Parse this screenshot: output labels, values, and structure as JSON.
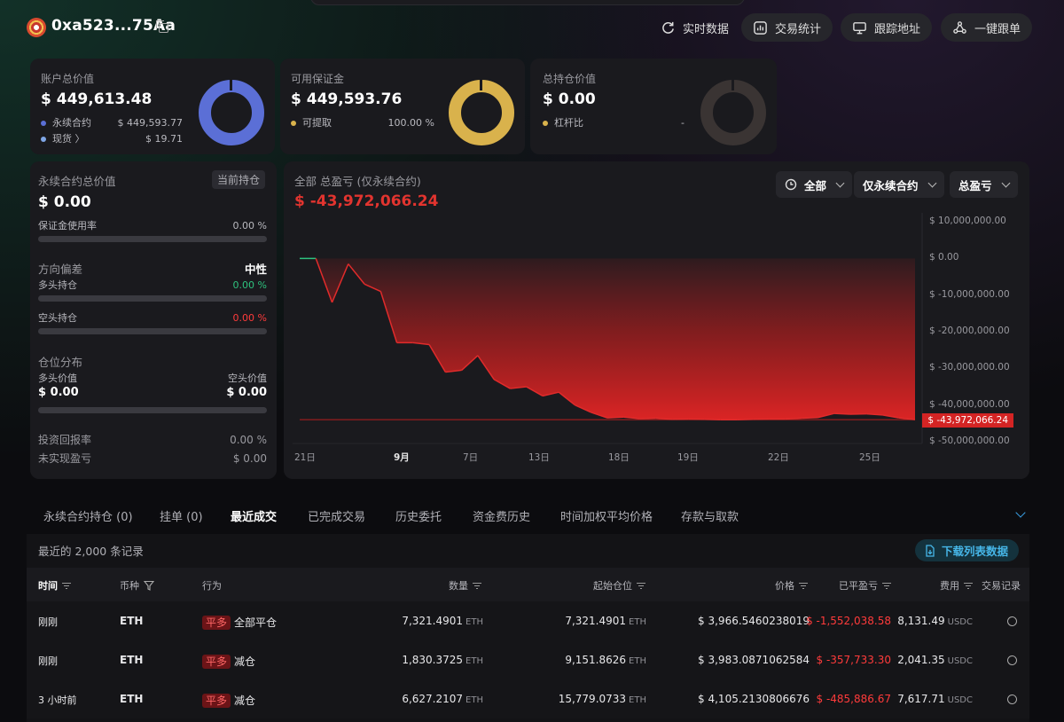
{
  "header": {
    "address": "0xa523...75Aa",
    "buttons": [
      "实时数据",
      "交易统计",
      "跟踪地址",
      "一键跟单"
    ]
  },
  "summary": {
    "total_value": {
      "label": "账户总价值",
      "value": "$ 449,613.48",
      "rows": [
        {
          "name": "永续合约",
          "value": "$ 449,593.77",
          "color": "#5b6fd6"
        },
        {
          "name": "现货 〉",
          "value": "$ 19.71",
          "color": "#7fa6e6"
        }
      ],
      "ring_fill_pct": 99.99
    },
    "available_margin": {
      "label": "可用保证金",
      "value": "$ 449,593.76",
      "rows": [
        {
          "name": "可提取",
          "value": "100.00 %",
          "color": "#d9b24c"
        }
      ],
      "ring_fill_pct": 100
    },
    "position_value": {
      "label": "总持仓价值",
      "value": "$ 0.00",
      "rows": [
        {
          "name": "杠杆比",
          "value": "-",
          "color": "#d9b24c"
        }
      ],
      "ring_fill_pct": 0
    }
  },
  "perp": {
    "title": "永续合约总价值",
    "tag": "当前持仓",
    "value": "$ 0.00",
    "margin_usage_label": "保证金使用率",
    "margin_usage": "0.00 %",
    "direction_label": "方向偏差",
    "direction_value": "中性",
    "long_label": "多头持仓",
    "long_pct": "0.00 %",
    "short_label": "空头持仓",
    "short_pct": "0.00 %",
    "dist_label": "仓位分布",
    "long_value_label": "多头价值",
    "short_value_label": "空头价值",
    "long_value": "$ 0.00",
    "short_value": "$ 0.00",
    "roi_label": "投资回报率",
    "roi": "0.00 %",
    "unrealized_label": "未实现盈亏",
    "unrealized": "$ 0.00"
  },
  "pnl": {
    "title": "全部 总盈亏 (仅永续合约)",
    "value": "$ -43,972,066.24",
    "filters": [
      "全部",
      "仅永续合约",
      "总盈亏"
    ],
    "current_label": "$ -43,972,066.24"
  },
  "chart_data": {
    "type": "area",
    "x_ticks": [
      "21日",
      "9月",
      "7日",
      "13日",
      "18日",
      "19日",
      "22日",
      "25日"
    ],
    "y_ticks": [
      "$ 10,000,000.00",
      "$ 0.00",
      "$ -10,000,000.00",
      "$ -20,000,000.00",
      "$ -30,000,000.00",
      "$ -40,000,000.00",
      "$ -50,000,000.00"
    ],
    "ylim": [
      -50000000,
      10000000
    ],
    "values": [
      0,
      0,
      -12000000,
      -1500000,
      -7000000,
      -9000000,
      -23000000,
      -23000000,
      -23500000,
      -31000000,
      -30500000,
      -26500000,
      -33000000,
      -35500000,
      -35000000,
      -37500000,
      -36500000,
      -40000000,
      -42000000,
      -43500000,
      -43300000,
      -43700000,
      -43600000,
      -43900000,
      -43800000,
      -43900000,
      -44000000,
      -44000000,
      -43900000,
      -43800000,
      -43800000,
      -43600000,
      -43400000,
      -42300000,
      -42500000,
      -42400000,
      -42700000,
      -43500000,
      -43972066
    ]
  },
  "tabs": [
    "永续合约持仓 (0)",
    "挂单 (0)",
    "最近成交",
    "已完成交易",
    "历史委托",
    "资金费历史",
    "时间加权平均价格",
    "存款与取款"
  ],
  "table": {
    "record_count": "最近的 2,000 条记录",
    "download_label": "下载列表数据",
    "headers": [
      "时间",
      "币种",
      "行为",
      "数量",
      "起始仓位",
      "价格",
      "已平盈亏",
      "费用",
      "交易记录"
    ],
    "rows": [
      {
        "time": "刚刚",
        "coin": "ETH",
        "side": "平多",
        "action": "全部平仓",
        "qty": "7,321.4901",
        "qty_unit": "ETH",
        "start": "7,321.4901",
        "start_unit": "ETH",
        "price": "$ 3,966.5460238019",
        "pnl": "$ -1,552,038.58",
        "fee": "8,131.49",
        "fee_unit": "USDC"
      },
      {
        "time": "刚刚",
        "coin": "ETH",
        "side": "平多",
        "action": "减仓",
        "qty": "1,830.3725",
        "qty_unit": "ETH",
        "start": "9,151.8626",
        "start_unit": "ETH",
        "price": "$ 3,983.0871062584",
        "pnl": "$ -357,733.30",
        "fee": "2,041.35",
        "fee_unit": "USDC"
      },
      {
        "time": "3 小时前",
        "coin": "ETH",
        "side": "平多",
        "action": "减仓",
        "qty": "6,627.2107",
        "qty_unit": "ETH",
        "start": "15,779.0733",
        "start_unit": "ETH",
        "price": "$ 4,105.2130806676",
        "pnl": "$ -485,886.67",
        "fee": "7,617.71",
        "fee_unit": "USDC"
      }
    ]
  }
}
